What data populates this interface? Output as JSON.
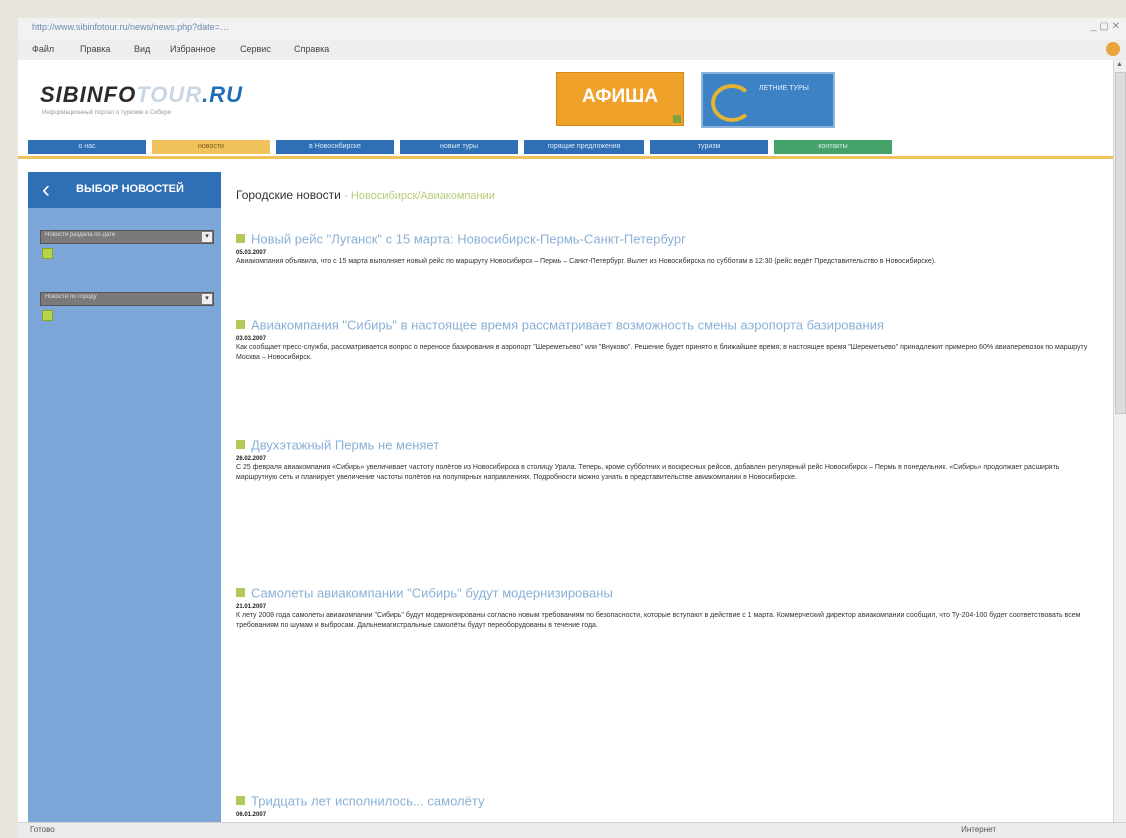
{
  "browser": {
    "url": "http://www.sibinfotour.ru/news/news.php?date=…",
    "menu": [
      "Файл",
      "Правка",
      "Вид",
      "Избранное",
      "Сервис",
      "Справка"
    ],
    "status_left": "Готово",
    "status_right": "Интернет"
  },
  "header": {
    "logo_sib": "SIBINFO",
    "logo_tour": "TOUR",
    "logo_ru": ".RU",
    "slogan": "Информационный портал о туризме в Сибири",
    "afisha": "АФИША",
    "banner2": "ЛЕТНИЕ ТУРЫ"
  },
  "nav": [
    "о нас",
    "новости",
    "в Новосибирске",
    "новые туры",
    "горящие предложения",
    "туризм",
    "контакты"
  ],
  "sidebar": {
    "title": "ВЫБОР НОВОСТЕЙ",
    "select1": "Новости раздела по дате",
    "select2": "Новости по городу"
  },
  "content": {
    "title": "Городские новости",
    "subtitle": "- Новосибирск/Авиакомпании"
  },
  "news": [
    {
      "title": "Новый рейс \"Луганск\" с 15 марта: Новосибирск-Пермь-Санкт-Петербург",
      "date": "05.03.2007",
      "text": "Авиакомпания объявила, что с 15 марта выполняет новый рейс по маршруту Новосибирск – Пермь – Санкт-Петербург. Вылет из Новосибирска по субботам в 12:30 (рейс ведёт Представительство в Новосибирске)."
    },
    {
      "title": "Авиакомпания \"Сибирь\" в настоящее время рассматривает возможность смены аэропорта базирования",
      "date": "03.03.2007",
      "text": "Как сообщает пресс-служба, рассматривается вопрос о переносе базирования в аэропорт \"Шереметьево\" или \"Внуково\". Решение будет принято в ближайшее время; в настоящее время \"Шереметьево\" принадлежит примерно 60% авиаперевозок по маршруту Москва – Новосибирск."
    },
    {
      "title": "Двухэтажный Пермь не меняет",
      "date": "26.02.2007",
      "text": "С 25 февраля авиакомпания «Сибирь» увеличивает частоту полётов из Новосибирска в столицу Урала. Теперь, кроме субботних и воскресных рейсов, добавлен регулярный рейс Новосибирск – Пермь в понедельник. «Сибирь» продолжает расширять маршрутную сеть и планирует увеличение частоты полётов на популярных направлениях. Подробности можно узнать в представительстве авиакомпании в Новосибирске."
    },
    {
      "title": "Самолеты авиакомпании \"Сибирь\" будут модернизированы",
      "date": "21.01.2007",
      "text": "К лету 2008 года самолеты авиакомпании \"Сибирь\" будут модернизированы согласно новым требованиям по безопасности, которые вступают в действие с 1 марта. Коммерческий директор авиакомпании сообщил, что Ту-204-100 будет соответствовать всем требованиям по шумам и выбросам. Дальнемагистральные самолёты будут переоборудованы в течение года."
    },
    {
      "title": "Тридцать лет исполнилось... самолёту",
      "date": "06.01.2007",
      "text": ""
    }
  ]
}
